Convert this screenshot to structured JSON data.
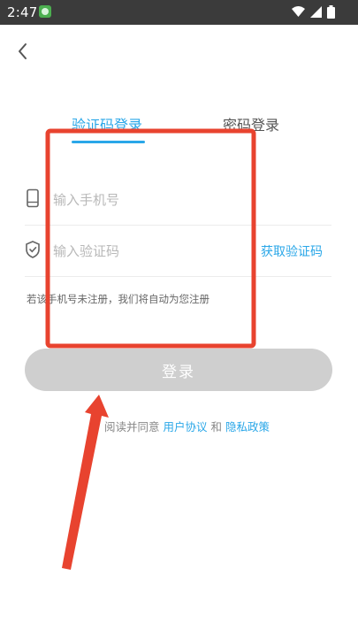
{
  "status_bar": {
    "time": "2:47"
  },
  "tabs": {
    "sms_login": "验证码登录",
    "password_login": "密码登录"
  },
  "form": {
    "phone_placeholder": "输入手机号",
    "code_placeholder": "输入验证码",
    "get_code": "获取验证码",
    "hint": "若该手机号未注册，我们将自动为您注册"
  },
  "login_button": "登录",
  "agreement": {
    "prefix": "阅读并同意",
    "user_agreement": "用户协议",
    "and": "和",
    "privacy_policy": "隐私政策"
  },
  "annotation": {
    "highlight_color": "#e8432f"
  }
}
